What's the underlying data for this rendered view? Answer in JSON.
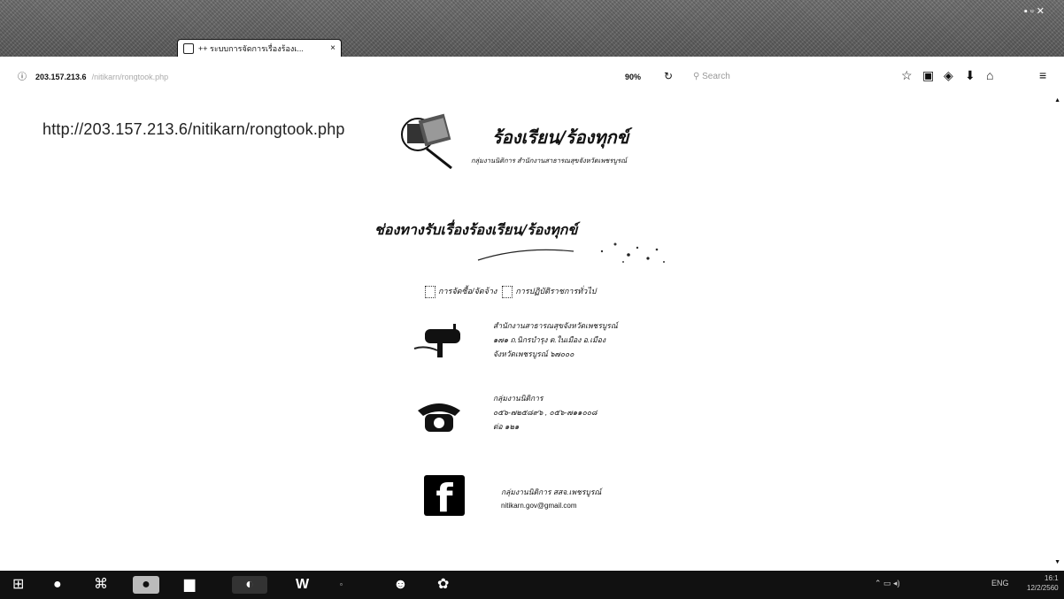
{
  "browser": {
    "tab_title": "++ ระบบการจัดการเรื่องร้องเ...",
    "tab_close": "×",
    "address": "203.157.213.6",
    "address_path": "/nitikarn/rongtook.php",
    "zoom": "90%",
    "search_placeholder": "Search"
  },
  "page": {
    "url_text": "http://203.157.213.6/nitikarn/rongtook.php",
    "logo_title": "ร้องเรียน/ร้องทุกข์",
    "logo_subtitle": "กลุ่มงานนิติการ สำนักงานสาธารณสุขจังหวัดเพชรบูรณ์",
    "channels_heading": "ช่องทางรับเรื่องร้องเรียน/ร้องทุกข์",
    "option_1": "การจัดซื้อ/จัดจ้าง",
    "option_2": "การปฏิบัติราชการทั่วไป",
    "mail": {
      "line1": "สำนักงานสาธารณสุขจังหวัดเพชรบูรณ์",
      "line2": "๑๗๑ ถ.นิกรบำรุง ต.ในเมือง อ.เมือง",
      "line3": "จังหวัดเพชรบูรณ์  ๖๗๐๐๐"
    },
    "phone": {
      "line1": "กลุ่มงานนิติการ",
      "line2": "๐๕๖-๗๒๕๘๙๖ , ๐๕๖-๗๑๑๐๐๘",
      "line3": "ต่อ ๑๒๑"
    },
    "facebook": {
      "line1": "กลุ่มงานนิติการ สสจ.เพชรบูรณ์",
      "line2": "nitikarn.gov@gmail.com"
    }
  },
  "taskbar": {
    "clock_time": "16:1",
    "clock_date": "12/2/2560",
    "lang": "ENG"
  }
}
